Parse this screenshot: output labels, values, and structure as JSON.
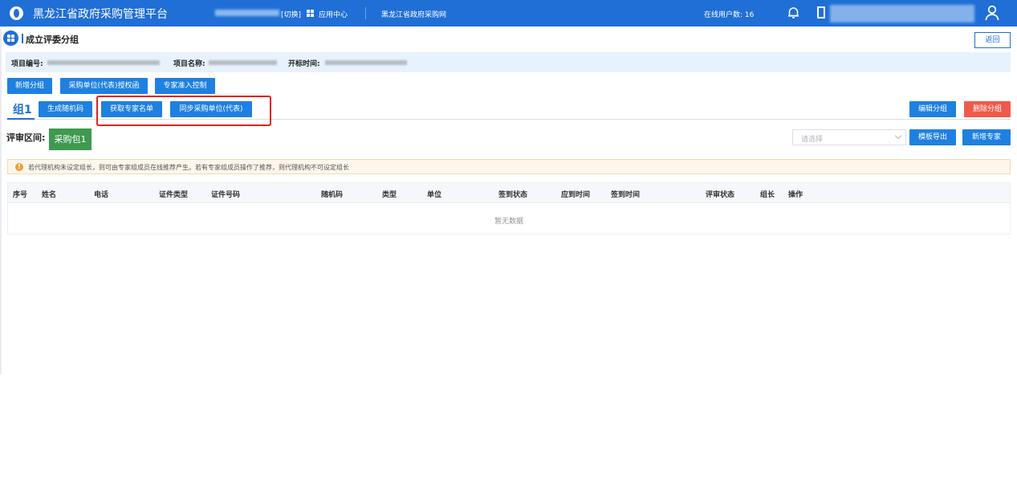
{
  "topbar": {
    "title": "黑龙江省政府采购管理平台",
    "switch_label": "[切换]",
    "app_center": "应用中心",
    "portal_link": "黑龙江省政府采购网",
    "online_users": "在线用户数: 16"
  },
  "page": {
    "title": "成立评委分组",
    "back": "返回"
  },
  "info": {
    "project_no_label": "项目编号:",
    "project_name_label": "项目名称:",
    "open_time_label": "开标时间:"
  },
  "toolbar": {
    "add_group": "新增分组",
    "purchaser_auth": "采购单位(代表)授权函",
    "expert_access": "专家准入控制"
  },
  "group": {
    "tab": "组1",
    "gen_random": "生成随机码",
    "get_experts": "获取专家名单",
    "sync_purchaser": "同步采购单位(代表)",
    "edit_group": "编辑分组",
    "delete_group": "删除分组"
  },
  "review": {
    "label": "评审区间:",
    "package": "采购包1",
    "select_placeholder": "请选择",
    "export_template": "模板导出",
    "add_expert": "新增专家"
  },
  "notice": "若代理机构未设定组长，则可由专家组成员在线推荐产生。若有专家组成员操作了推荐，则代理机构不可设定组长",
  "table": {
    "columns": [
      "序号",
      "姓名",
      "电话",
      "证件类型",
      "证件号码",
      "随机码",
      "类型",
      "单位",
      "签到状态",
      "应到时间",
      "签到时间",
      "评审状态",
      "组长",
      "操作"
    ],
    "empty": "暂无数据"
  },
  "colors": {
    "brand": "#1f6fd6",
    "button": "#1f80e0",
    "danger": "#f05a4a",
    "package": "#3e9a4f",
    "highlight_border": "#e02020"
  }
}
